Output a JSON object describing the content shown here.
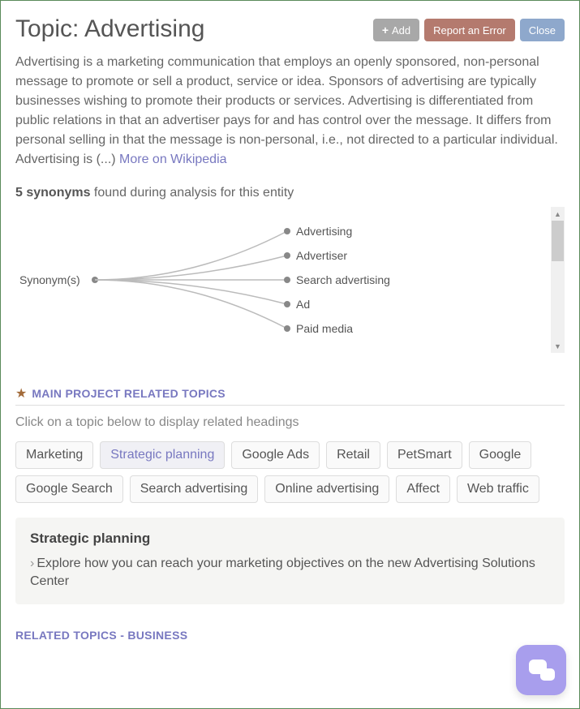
{
  "title": "Topic: Advertising",
  "buttons": {
    "add": "Add",
    "report": "Report an Error",
    "close": "Close"
  },
  "description": "Advertising is a marketing communication that employs an openly sponsored, non-personal message to promote or sell a product, service or idea. Sponsors of advertising are typically businesses wishing to promote their products or services. Advertising is differentiated from public relations in that an advertiser pays for and has control over the message. It differs from personal selling in that the message is non-personal, i.e., not directed to a particular individual. Advertising is (...) ",
  "wiki_link": "More on Wikipedia",
  "synonyms": {
    "count_label": "5 synonyms",
    "suffix": " found during analysis for this entity",
    "root": "Synonym(s)",
    "items": [
      "Advertising",
      "Advertiser",
      "Search advertising",
      "Ad",
      "Paid media"
    ]
  },
  "main_section": {
    "title": "MAIN PROJECT RELATED TOPICS",
    "subtitle": "Click on a topic below to display related headings",
    "topics": [
      "Marketing",
      "Strategic planning",
      "Google Ads",
      "Retail",
      "PetSmart",
      "Google",
      "Google Search",
      "Search advertising",
      "Online advertising",
      "Affect",
      "Web traffic"
    ],
    "active_index": 1
  },
  "detail": {
    "title": "Strategic planning",
    "item": "Explore how you can reach your marketing objectives on the new Advertising Solutions Center"
  },
  "related_section": {
    "title": "RELATED TOPICS - BUSINESS"
  }
}
